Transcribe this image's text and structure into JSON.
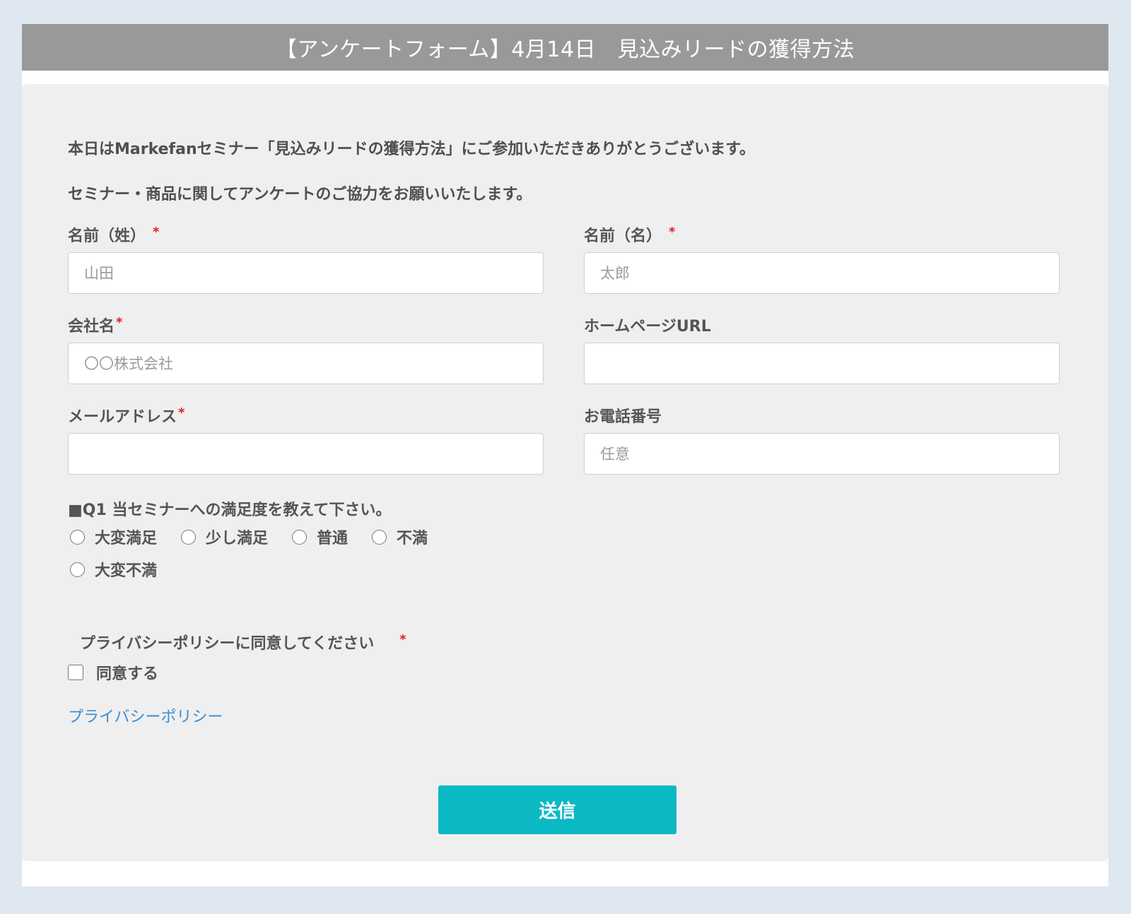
{
  "header": {
    "title": "【アンケートフォーム】4月14日　見込みリードの獲得方法"
  },
  "intro": {
    "line1": "本日はMarkefanセミナー「見込みリードの獲得方法」にご参加いただきありがとうございます。",
    "line2": "セミナー・商品に関してアンケートのご協力をお願いいたします。"
  },
  "fields": {
    "last_name": {
      "label": "名前（姓）",
      "required_mark": "*",
      "placeholder": "山田",
      "value": ""
    },
    "first_name": {
      "label": "名前（名）",
      "required_mark": "*",
      "placeholder": "太郎",
      "value": ""
    },
    "company": {
      "label": "会社名",
      "required_mark": "*",
      "placeholder": "〇〇株式会社",
      "value": ""
    },
    "homepage": {
      "label": "ホームページURL",
      "placeholder": "",
      "value": ""
    },
    "email": {
      "label": "メールアドレス",
      "required_mark": "*",
      "placeholder": "",
      "value": ""
    },
    "phone": {
      "label": "お電話番号",
      "placeholder": "任意",
      "value": ""
    }
  },
  "q1": {
    "question": "■Q1 当セミナーへの満足度を教えて下さい。",
    "options": [
      "大変満足",
      "少し満足",
      "普通",
      "不満",
      "大変不満"
    ]
  },
  "privacy": {
    "title": "プライバシーポリシーに同意してください",
    "required_mark": "*",
    "agree_label": "同意する",
    "link_text": "プライバシーポリシー"
  },
  "submit": {
    "label": "送信"
  },
  "colors": {
    "header_bg": "#999999",
    "panel_bg": "#efefef",
    "page_bg": "#dfe7f1",
    "accent": "#0bb9c4",
    "required": "#e02020",
    "link": "#3a8fd4"
  }
}
